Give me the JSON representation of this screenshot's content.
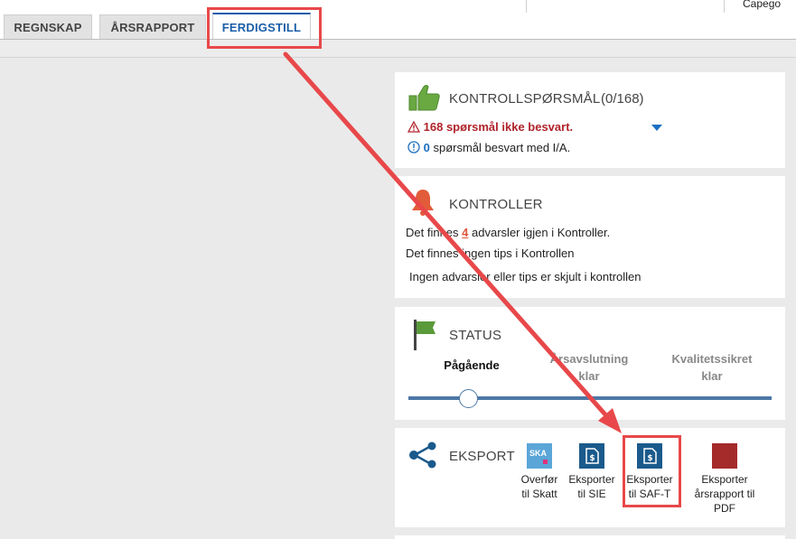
{
  "header": {
    "user": "Capego"
  },
  "tabs": [
    {
      "label": "REGNSKAP"
    },
    {
      "label": "ÅRSRAPPORT"
    },
    {
      "label": "FERDIGSTILL",
      "active": true
    }
  ],
  "kontrollsporsmal": {
    "title": "KONTROLLSPØRSMÅL",
    "count": "(0/168)",
    "unanswered_count": "168",
    "unanswered_text": "spørsmål ikke besvart.",
    "ia_count": "0",
    "ia_text": "spørsmål besvart med I/A."
  },
  "kontroller": {
    "title": "KONTROLLER",
    "warnings_prefix": "Det finnes",
    "warnings_count": "4",
    "warnings_suffix": "advarsler igjen i Kontroller.",
    "tips_text": "Det finnes ingen tips i Kontrollen",
    "hidden_text": "Ingen advarsler eller tips er skjult i kontrollen"
  },
  "status": {
    "title": "STATUS",
    "stages": [
      {
        "line1": "Pågående",
        "line2": ""
      },
      {
        "line1": "Årsavslutning",
        "line2": "klar"
      },
      {
        "line1": "Kvalitetssikret",
        "line2": "klar"
      }
    ],
    "current_stage_index": 0
  },
  "eksport": {
    "title": "EKSPORT",
    "items": [
      {
        "line1": "Overfør",
        "line2": "til Skatt",
        "line3": "",
        "icon": "ska-icon",
        "icon_text": "SKA"
      },
      {
        "line1": "Eksporter",
        "line2": "til SIE",
        "line3": "",
        "icon": "document-export-icon"
      },
      {
        "line1": "Eksporter",
        "line2": "til SAF-T",
        "line3": "",
        "icon": "document-export-icon"
      },
      {
        "line1": "Eksporter",
        "line2": "årsrapport til",
        "line3": "PDF",
        "icon": "pdf-icon"
      }
    ]
  },
  "colors": {
    "accent": "#1a5ea8",
    "highlight": "#e8484a",
    "warning": "#b0232a",
    "info": "#1d6fc0",
    "status_green": "#5a9a3a"
  }
}
